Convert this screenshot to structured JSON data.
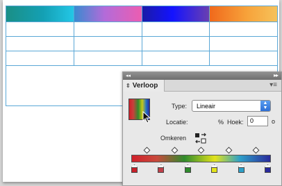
{
  "panel": {
    "tab_label": "Verloop",
    "type_label": "Type:",
    "type_value": "Lineair",
    "location_label": "Locatie:",
    "location_unit": "%",
    "angle_label": "Hoek:",
    "angle_value": "0",
    "angle_unit": "o",
    "reverse_label": "Omkeren"
  },
  "gradient_stops": [
    {
      "color": "#c8202a"
    },
    {
      "color": "#c0404a"
    },
    {
      "color": "#2f8b2c"
    },
    {
      "color": "#e3e31c"
    },
    {
      "color": "#2ea0c8"
    },
    {
      "color": "#2a2a9c"
    }
  ],
  "header_gradients": [
    {
      "from": "#1a8f86",
      "to": "#23c7e6"
    },
    {
      "from": "#3a8ad0",
      "to": "#ec5db1"
    },
    {
      "from": "#1b1aa6",
      "to": "#6a3fb0"
    },
    {
      "from": "#f0691c",
      "to": "#f6c25a"
    }
  ]
}
